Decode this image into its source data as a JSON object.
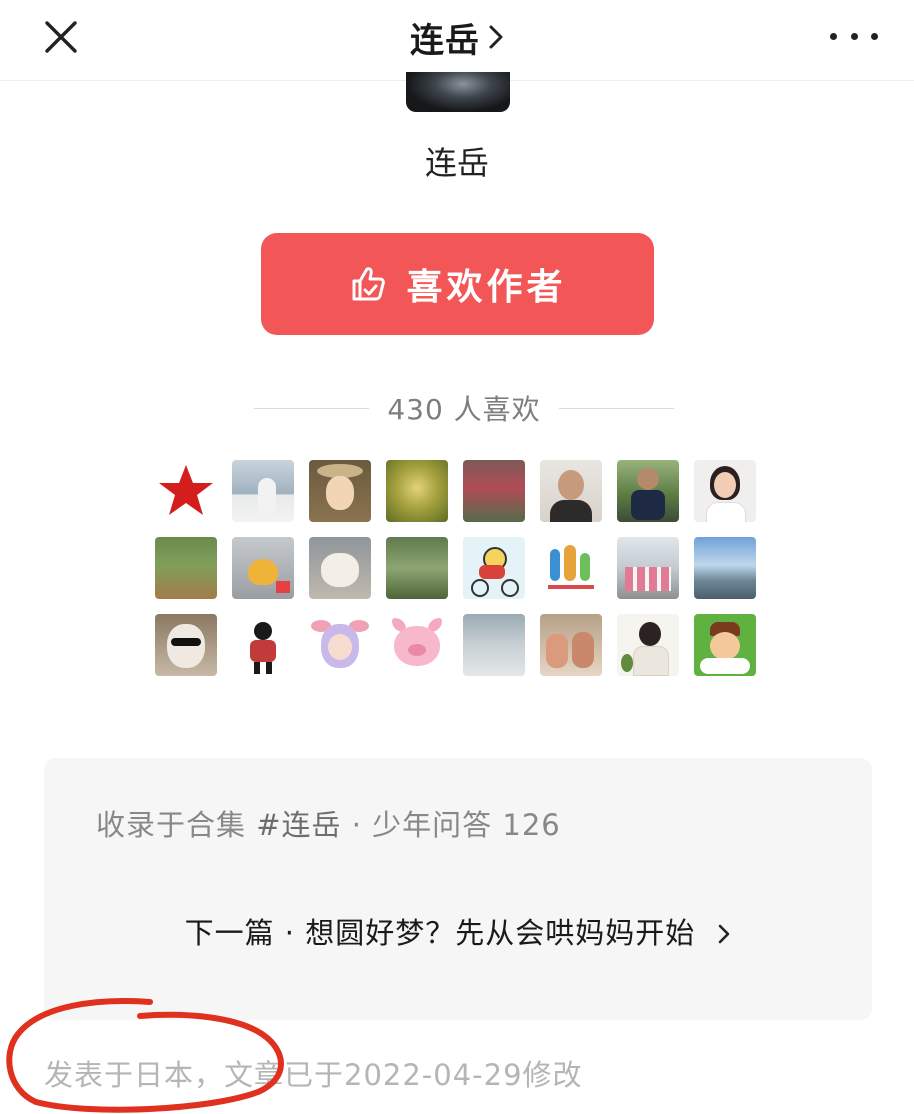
{
  "header": {
    "title": "连岳",
    "title_chevron": "›",
    "close_icon": "close-icon",
    "more_icon": "more-icon"
  },
  "author": {
    "name": "连岳"
  },
  "like_button": {
    "label": "喜欢作者",
    "icon": "thumbs-up-icon",
    "color": "#f25656"
  },
  "likes": {
    "count_text": "430 人喜欢",
    "avatars": [
      {
        "icon": "red-star-icon"
      },
      {
        "icon": "photo-person-city"
      },
      {
        "icon": "cartoon-girl-hat"
      },
      {
        "icon": "photo-plant"
      },
      {
        "icon": "photo-red-tree"
      },
      {
        "icon": "photo-woman"
      },
      {
        "icon": "photo-man-motorbike"
      },
      {
        "icon": "photo-woman-smiling"
      },
      {
        "icon": "photo-green-field"
      },
      {
        "icon": "photo-duck-toy"
      },
      {
        "icon": "photo-cat"
      },
      {
        "icon": "photo-forest"
      },
      {
        "icon": "cartoon-bike-rider"
      },
      {
        "icon": "family-logo"
      },
      {
        "icon": "photo-group"
      },
      {
        "icon": "photo-sky-landscape"
      },
      {
        "icon": "photo-cat-sunglasses"
      },
      {
        "icon": "cartoon-black-figure"
      },
      {
        "icon": "cartoon-cow-girl"
      },
      {
        "icon": "cartoon-pink-pig"
      },
      {
        "icon": "photo-misty-lake"
      },
      {
        "icon": "photo-women-sitting"
      },
      {
        "icon": "photo-woman-plant"
      },
      {
        "icon": "cartoon-boy-green"
      }
    ]
  },
  "collection": {
    "prefix": "收录于合集 ",
    "tag": "#连岳",
    "suffix": " · 少年问答 126",
    "next_text": "下一篇 · 想圆好梦？先从会哄妈妈开始",
    "next_chevron": "›"
  },
  "meta": {
    "text": "发表于日本，文章已于2022-04-29修改"
  },
  "colors": {
    "accent": "#f25656",
    "annotation": "#e0301f"
  }
}
